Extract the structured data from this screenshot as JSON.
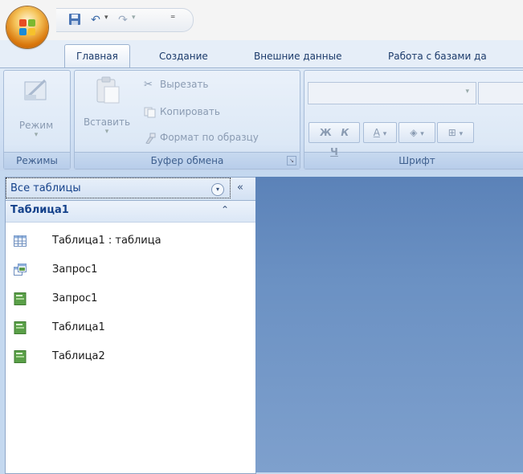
{
  "tabs": [
    {
      "label": "Главная",
      "active": true
    },
    {
      "label": "Создание",
      "active": false
    },
    {
      "label": "Внешние данные",
      "active": false
    },
    {
      "label": "Работа с базами да",
      "active": false
    }
  ],
  "ribbon": {
    "modes": {
      "mode_label": "Режим",
      "group_label": "Режимы"
    },
    "clipboard": {
      "paste_label": "Вставить",
      "cut_label": "Вырезать",
      "copy_label": "Копировать",
      "format_painter_label": "Формат по образцу",
      "group_label": "Буфер обмена"
    },
    "font": {
      "bold": "Ж",
      "italic": "К",
      "underline": "Ч",
      "font_color": "A",
      "group_label": "Шрифт"
    }
  },
  "nav": {
    "title": "Все таблицы",
    "group_title": "Таблица1",
    "items": [
      {
        "label": "Таблица1 : таблица",
        "icon": "table-icon"
      },
      {
        "label": "Запрос1",
        "icon": "query-icon"
      },
      {
        "label": "Запрос1",
        "icon": "form-icon"
      },
      {
        "label": "Таблица1",
        "icon": "form-icon"
      },
      {
        "label": "Таблица2",
        "icon": "form-icon"
      }
    ]
  },
  "colors": {
    "accent": "#15428b",
    "workspace": "#6b91c3",
    "office_button": "#f5c45a"
  }
}
